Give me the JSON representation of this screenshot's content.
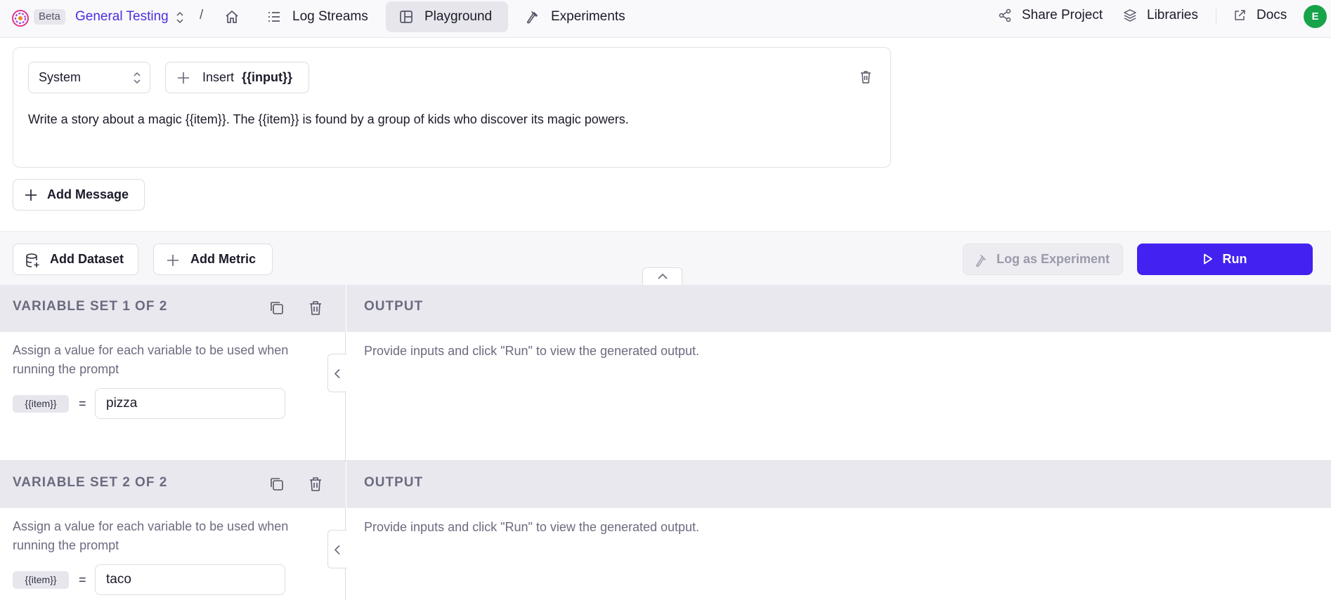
{
  "header": {
    "beta": "Beta",
    "project": "General Testing",
    "separator": "/",
    "nav": [
      {
        "label": "Log Streams",
        "icon": "list-icon"
      },
      {
        "label": "Playground",
        "icon": "layout-icon",
        "active": true
      },
      {
        "label": "Experiments",
        "icon": "flask-icon"
      }
    ],
    "share": "Share Project",
    "libraries": "Libraries",
    "docs": "Docs",
    "avatar": "E"
  },
  "message": {
    "role": "System",
    "insert_prefix": "Insert",
    "insert_token": "{{input}}",
    "prompt": "Write a story about a magic {{item}}. The {{item}} is found by a group of kids who discover its magic powers."
  },
  "add_message": "Add Message",
  "toolbar": {
    "add_dataset": "Add Dataset",
    "add_metric": "Add Metric",
    "log_experiment": "Log as Experiment",
    "run": "Run"
  },
  "variable_sets": [
    {
      "title": "VARIABLE SET 1 OF 2",
      "output_title": "OUTPUT",
      "description": "Assign a value for each variable to be used when running the prompt",
      "var_name": "{{item}}",
      "equals": "=",
      "value": "pizza",
      "output": "Provide inputs and click \"Run\" to view the generated output."
    },
    {
      "title": "VARIABLE SET 2 OF 2",
      "output_title": "OUTPUT",
      "description": "Assign a value for each variable to be used when running the prompt",
      "var_name": "{{item}}",
      "equals": "=",
      "value": "taco",
      "output": "Provide inputs and click \"Run\" to view the generated output."
    }
  ],
  "colors": {
    "accent": "#4321f0",
    "project_link": "#4b2ee0",
    "avatar": "#17a34a"
  }
}
